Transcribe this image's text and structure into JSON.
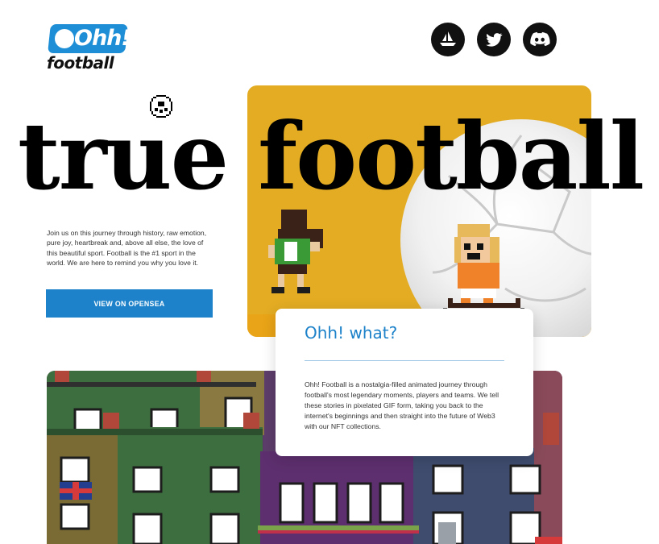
{
  "brand": {
    "logo_top": "Ohh!",
    "logo_bottom": "football",
    "accent": "#1e8fd6"
  },
  "social": [
    {
      "name": "opensea",
      "icon": "opensea-icon"
    },
    {
      "name": "twitter",
      "icon": "twitter-icon"
    },
    {
      "name": "discord",
      "icon": "discord-icon"
    }
  ],
  "hero": {
    "headline_1": "true",
    "headline_2": "football"
  },
  "intro": {
    "text": "Join us on this journey through history, raw emotion, pure joy, heartbreak and, above all else, the love of this beautiful sport. Football is the #1 sport in the world. We are here to remind you why you love it.",
    "cta_label": "VIEW ON OPENSEA",
    "cta_color": "#1d82c9"
  },
  "about": {
    "title": "Ohh! what?",
    "body": "Ohh! Football is a nostalgia-filled animated journey through football's most legendary moments, players and teams. We tell these stories in pixelated GIF form, taking you back to the internet's beginnings and then straight into the future of Web3 with our NFT collections."
  }
}
